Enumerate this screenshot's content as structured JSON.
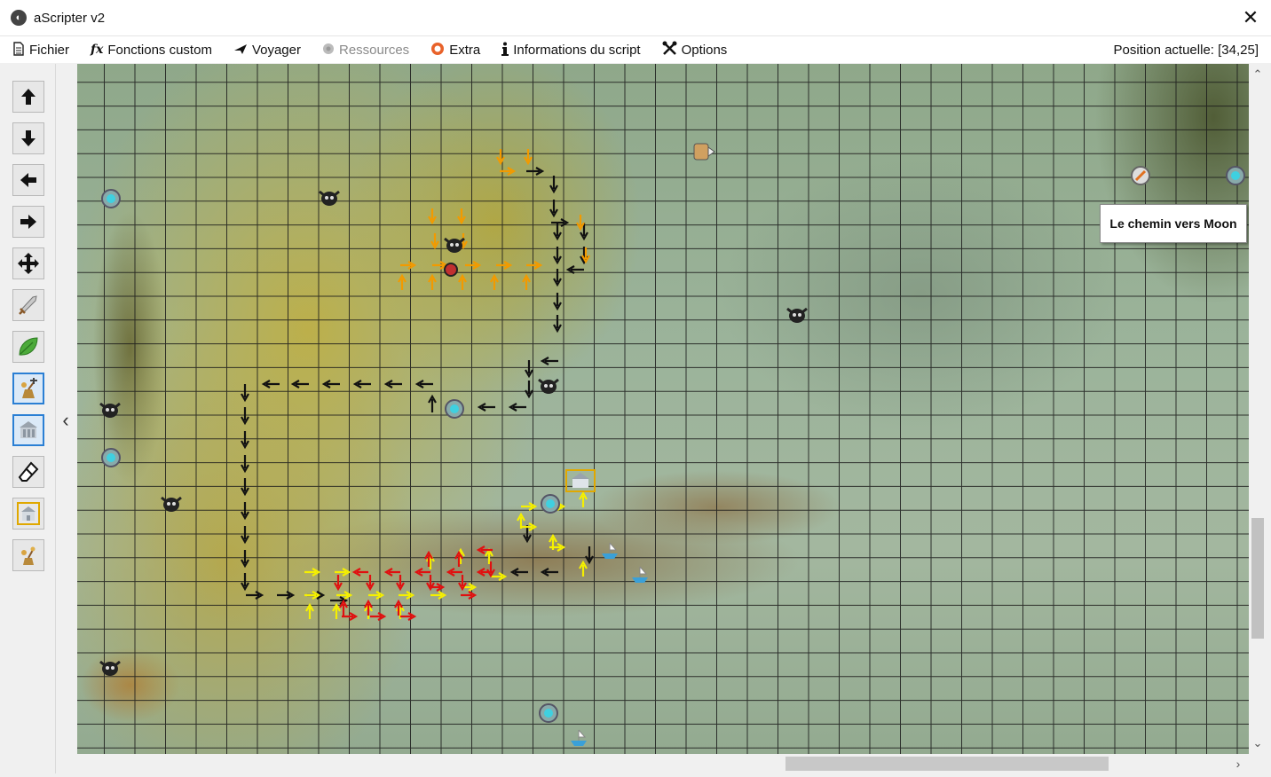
{
  "window": {
    "title": "aScripter v2",
    "close_glyph": "✕"
  },
  "menu": {
    "items": [
      {
        "label": "Fichier",
        "icon": "file-icon",
        "enabled": true
      },
      {
        "label": "Fonctions custom",
        "icon": "fx-icon",
        "enabled": true
      },
      {
        "label": "Voyager",
        "icon": "plane-icon",
        "enabled": true
      },
      {
        "label": "Ressources",
        "icon": "resource-icon",
        "enabled": false
      },
      {
        "label": "Extra",
        "icon": "extra-icon",
        "enabled": true
      },
      {
        "label": "Informations du script",
        "icon": "info-icon",
        "enabled": true
      },
      {
        "label": "Options",
        "icon": "tools-icon",
        "enabled": true
      }
    ],
    "fx_glyph": "fx",
    "position": "Position actuelle: [34,25]"
  },
  "toolbar": {
    "tools": [
      {
        "name": "move-up",
        "icon": "arrow-up-icon",
        "selected": false
      },
      {
        "name": "move-down",
        "icon": "arrow-down-icon",
        "selected": false
      },
      {
        "name": "move-left",
        "icon": "arrow-left-icon",
        "selected": false
      },
      {
        "name": "move-right",
        "icon": "arrow-right-icon",
        "selected": false
      },
      {
        "name": "move-all",
        "icon": "move-all-icon",
        "selected": false
      },
      {
        "name": "fight",
        "icon": "sword-icon",
        "selected": false
      },
      {
        "name": "gather",
        "icon": "leaf-icon",
        "selected": false
      },
      {
        "name": "zaap-move",
        "icon": "zaap-icon",
        "selected": true
      },
      {
        "name": "bank",
        "icon": "bank-icon",
        "selected": false
      },
      {
        "name": "eraser",
        "icon": "eraser-icon",
        "selected": false
      },
      {
        "name": "building",
        "icon": "building-icon",
        "selected": false
      },
      {
        "name": "zaap",
        "icon": "zaap-small-icon",
        "selected": false
      }
    ],
    "collapse_glyph": "‹"
  },
  "map": {
    "tooltip": "Le chemin vers Moon",
    "colors": {
      "grid": "#1a1a1a",
      "path_black": "#111111",
      "path_orange": "#f29a00",
      "path_yellow": "#f5f000",
      "path_red": "#e01010"
    }
  },
  "scroll": {
    "up": "⌃",
    "down": "⌄",
    "right": "›"
  }
}
